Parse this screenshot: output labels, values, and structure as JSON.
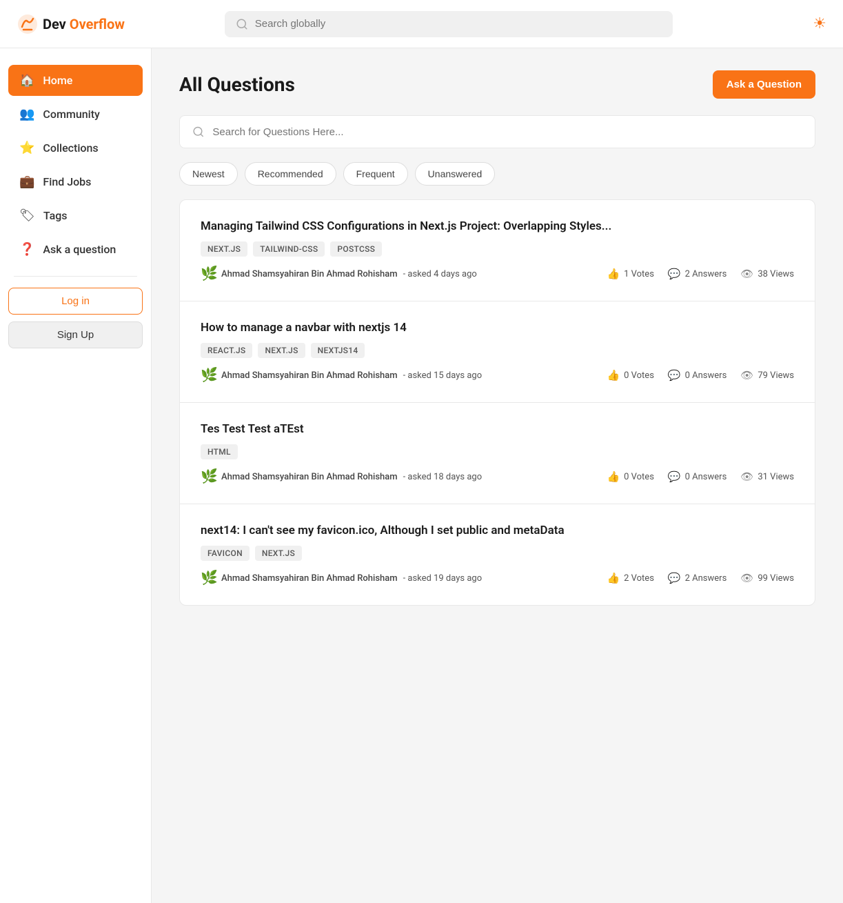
{
  "header": {
    "logo_dev": "Dev",
    "logo_overflow": "Overflow",
    "search_placeholder": "Search globally",
    "theme_icon": "☀"
  },
  "sidebar": {
    "nav_items": [
      {
        "id": "home",
        "label": "Home",
        "icon": "🏠",
        "active": true
      },
      {
        "id": "community",
        "label": "Community",
        "icon": "👥",
        "active": false
      },
      {
        "id": "collections",
        "label": "Collections",
        "icon": "⭐",
        "active": false
      },
      {
        "id": "find-jobs",
        "label": "Find Jobs",
        "icon": "💼",
        "active": false
      },
      {
        "id": "tags",
        "label": "Tags",
        "icon": "🏷",
        "active": false
      },
      {
        "id": "ask-question",
        "label": "Ask a question",
        "icon": "❓",
        "active": false
      }
    ],
    "login_label": "Log in",
    "signup_label": "Sign Up"
  },
  "main": {
    "page_title": "All Questions",
    "ask_button": "Ask a Question",
    "search_placeholder": "Search for Questions Here...",
    "filter_tabs": [
      {
        "id": "newest",
        "label": "Newest"
      },
      {
        "id": "recommended",
        "label": "Recommended"
      },
      {
        "id": "frequent",
        "label": "Frequent"
      },
      {
        "id": "unanswered",
        "label": "Unanswered"
      }
    ],
    "questions": [
      {
        "id": 1,
        "title": "Managing Tailwind CSS Configurations in Next.js Project: Overlapping Styles...",
        "tags": [
          "NEXT.JS",
          "TAILWIND-CSS",
          "POSTCSS"
        ],
        "author": "Ahmad Shamsyahiran Bin Ahmad Rohisham",
        "time_ago": "asked 4 days ago",
        "votes": 1,
        "votes_label": "Votes",
        "answers": 2,
        "answers_label": "Answers",
        "views": 38,
        "views_label": "Views"
      },
      {
        "id": 2,
        "title": "How to manage a navbar with nextjs 14",
        "tags": [
          "REACT.JS",
          "NEXT.JS",
          "NEXTJS14"
        ],
        "author": "Ahmad Shamsyahiran Bin Ahmad Rohisham",
        "time_ago": "asked 15 days ago",
        "votes": 0,
        "votes_label": "Votes",
        "answers": 0,
        "answers_label": "Answers",
        "views": 79,
        "views_label": "Views"
      },
      {
        "id": 3,
        "title": "Tes Test Test aTEst",
        "tags": [
          "HTML"
        ],
        "author": "Ahmad Shamsyahiran Bin Ahmad Rohisham",
        "time_ago": "asked 18 days ago",
        "votes": 0,
        "votes_label": "Votes",
        "answers": 0,
        "answers_label": "Answers",
        "views": 31,
        "views_label": "Views"
      },
      {
        "id": 4,
        "title": "next14: I can't see my favicon.ico, Although I set public and metaData",
        "tags": [
          "FAVICON",
          "NEXT.JS"
        ],
        "author": "Ahmad Shamsyahiran Bin Ahmad Rohisham",
        "time_ago": "asked 19 days ago",
        "votes": 2,
        "votes_label": "Votes",
        "answers": 2,
        "answers_label": "Answers",
        "views": 99,
        "views_label": "Views"
      }
    ]
  }
}
